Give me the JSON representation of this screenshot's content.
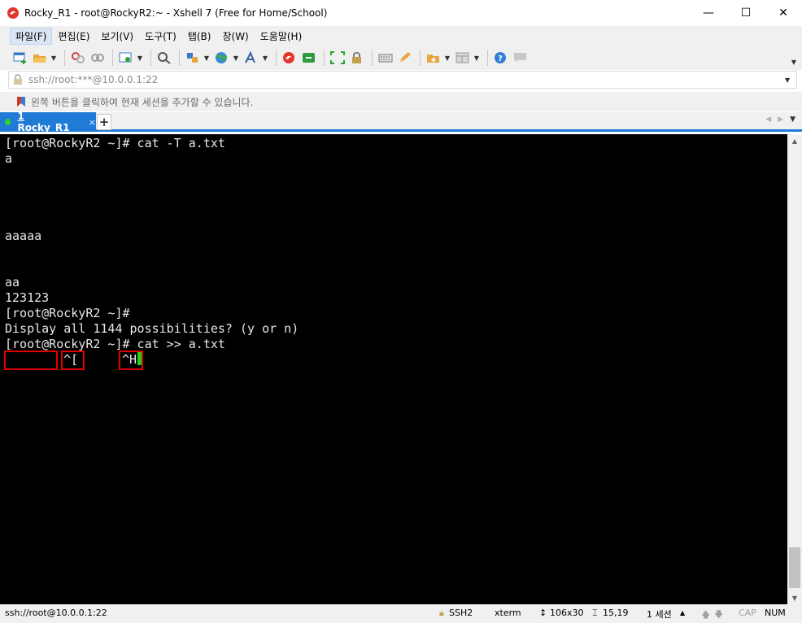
{
  "window": {
    "title": "Rocky_R1 - root@RockyR2:~ - Xshell 7 (Free for Home/School)",
    "minimize": "—",
    "maximize": "☐",
    "close": "✕"
  },
  "menu": {
    "items": [
      "파일(F)",
      "편집(E)",
      "보기(V)",
      "도구(T)",
      "탭(B)",
      "창(W)",
      "도움말(H)"
    ]
  },
  "address": {
    "value": "ssh://root:***@10.0.0.1:22"
  },
  "info_bar": {
    "text": "왼쪽 버튼을 클릭하여 현재 세션을 추가할 수 있습니다."
  },
  "tabs": {
    "active_label": "1 Rocky_R1",
    "close": "×",
    "add": "+"
  },
  "terminal": {
    "lines": [
      "[root@RockyR2 ~]# cat -T a.txt",
      "a",
      "",
      "",
      "",
      "",
      "aaaaa",
      "",
      "",
      "aa",
      "123123",
      "[root@RockyR2 ~]#",
      "Display all 1144 possibilities? (y or n)",
      "[root@RockyR2 ~]# cat >> a.txt"
    ],
    "control_chars": [
      "^[",
      "^H"
    ]
  },
  "status": {
    "connection": "ssh://root@10.0.0.1:22",
    "protocol": "SSH2",
    "terminal_type": "xterm",
    "size": "106x30",
    "cursor_pos": "15,19",
    "sessions": "1 세션",
    "caps": "CAP",
    "num": "NUM"
  },
  "colors": {
    "accent": "#1f7bd6",
    "terminal_bg": "#000000",
    "terminal_fg": "#e8e8e8",
    "cursor": "#1ed31e",
    "highlight_box": "#e00000"
  }
}
